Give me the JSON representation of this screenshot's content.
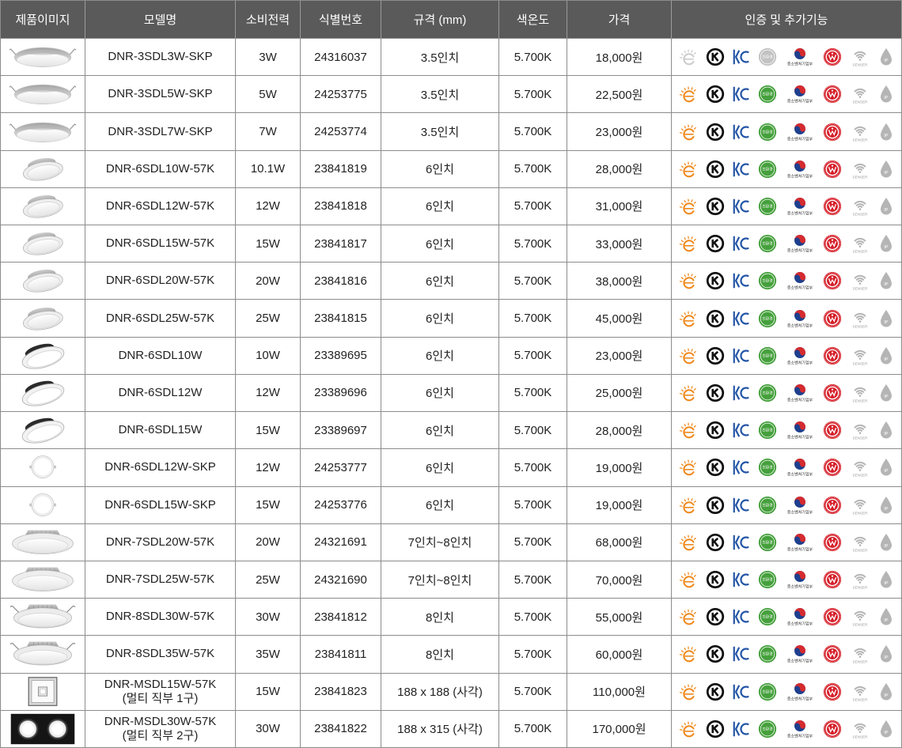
{
  "columns": [
    "제품이미지",
    "모델명",
    "소비전력",
    "식별번호",
    "규격 (mm)",
    "색온도",
    "가격",
    "인증 및 추가기능"
  ],
  "certifications": [
    {
      "icon": "high-efficiency-mark-icon"
    },
    {
      "icon": "k-mark-icon"
    },
    {
      "icon": "kc-mark-icon"
    },
    {
      "icon": "eco-mark-icon",
      "text": "친환경"
    },
    {
      "icon": "sme-ministry-mark-icon",
      "text": "중소벤처기업부"
    },
    {
      "icon": "quality-seal-icon"
    },
    {
      "icon": "sensor-icon",
      "text": "SENSER"
    },
    {
      "icon": "ip-rating-icon",
      "text": "IP"
    }
  ],
  "colors": {
    "header_bg": "#5a5a5a",
    "header_text": "#ffffff",
    "grid_line": "#8c8c8c",
    "body_text": "#222222",
    "efficiency_orange": "#f0891d",
    "kc_blue": "#2456a6",
    "eco_green": "#45a03c",
    "seal_red": "#d6202a",
    "feature_gray": "#b5b5b5"
  },
  "rows": [
    {
      "image": "slim-downlight",
      "model": "DNR-3SDL3W-SKP",
      "power": "3W",
      "id_number": "24316037",
      "size": "3.5인치",
      "color_temp": "5.700K",
      "price": "18,000원",
      "inactive_certs": [
        "high-efficiency-mark-icon",
        "eco-mark-icon"
      ]
    },
    {
      "image": "slim-downlight",
      "model": "DNR-3SDL5W-SKP",
      "power": "5W",
      "id_number": "24253775",
      "size": "3.5인치",
      "color_temp": "5.700K",
      "price": "22,500원"
    },
    {
      "image": "slim-downlight",
      "model": "DNR-3SDL7W-SKP",
      "power": "7W",
      "id_number": "24253774",
      "size": "3.5인치",
      "color_temp": "5.700K",
      "price": "23,000원"
    },
    {
      "image": "tilted-downlight",
      "model": "DNR-6SDL10W-57K",
      "power": "10.1W",
      "id_number": "23841819",
      "size": "6인치",
      "color_temp": "5.700K",
      "price": "28,000원"
    },
    {
      "image": "tilted-downlight",
      "model": "DNR-6SDL12W-57K",
      "power": "12W",
      "id_number": "23841818",
      "size": "6인치",
      "color_temp": "5.700K",
      "price": "31,000원"
    },
    {
      "image": "tilted-downlight",
      "model": "DNR-6SDL15W-57K",
      "power": "15W",
      "id_number": "23841817",
      "size": "6인치",
      "color_temp": "5.700K",
      "price": "33,000원"
    },
    {
      "image": "tilted-downlight",
      "model": "DNR-6SDL20W-57K",
      "power": "20W",
      "id_number": "23841816",
      "size": "6인치",
      "color_temp": "5.700K",
      "price": "38,000원"
    },
    {
      "image": "tilted-downlight",
      "model": "DNR-6SDL25W-57K",
      "power": "25W",
      "id_number": "23841815",
      "size": "6인치",
      "color_temp": "5.700K",
      "price": "45,000원"
    },
    {
      "image": "dark-housing-downlight",
      "model": "DNR-6SDL10W",
      "power": "10W",
      "id_number": "23389695",
      "size": "6인치",
      "color_temp": "5.700K",
      "price": "23,000원"
    },
    {
      "image": "dark-housing-downlight",
      "model": "DNR-6SDL12W",
      "power": "12W",
      "id_number": "23389696",
      "size": "6인치",
      "color_temp": "5.700K",
      "price": "25,000원"
    },
    {
      "image": "dark-housing-downlight",
      "model": "DNR-6SDL15W",
      "power": "15W",
      "id_number": "23389697",
      "size": "6인치",
      "color_temp": "5.700K",
      "price": "28,000원"
    },
    {
      "image": "round-downlight",
      "model": "DNR-6SDL12W-SKP",
      "power": "12W",
      "id_number": "24253777",
      "size": "6인치",
      "color_temp": "5.700K",
      "price": "19,000원"
    },
    {
      "image": "round-downlight",
      "model": "DNR-6SDL15W-SKP",
      "power": "15W",
      "id_number": "24253776",
      "size": "6인치",
      "color_temp": "5.700K",
      "price": "19,000원"
    },
    {
      "image": "wide-downlight",
      "model": "DNR-7SDL20W-57K",
      "power": "20W",
      "id_number": "24321691",
      "size": "7인치~8인치",
      "color_temp": "5.700K",
      "price": "68,000원"
    },
    {
      "image": "wide-downlight",
      "model": "DNR-7SDL25W-57K",
      "power": "25W",
      "id_number": "24321690",
      "size": "7인치~8인치",
      "color_temp": "5.700K",
      "price": "70,000원"
    },
    {
      "image": "wide-downlight-clips",
      "model": "DNR-8SDL30W-57K",
      "power": "30W",
      "id_number": "23841812",
      "size": "8인치",
      "color_temp": "5.700K",
      "price": "55,000원"
    },
    {
      "image": "wide-downlight-clips",
      "model": "DNR-8SDL35W-57K",
      "power": "35W",
      "id_number": "23841811",
      "size": "8인치",
      "color_temp": "5.700K",
      "price": "60,000원"
    },
    {
      "image": "square-single-lamp",
      "model": "DNR-MSDL15W-57K",
      "model_note": "(멀티 직부 1구)",
      "power": "15W",
      "id_number": "23841823",
      "size": "188 x 188 (사각)",
      "color_temp": "5.700K",
      "price": "110,000원"
    },
    {
      "image": "square-double-lamp",
      "model": "DNR-MSDL30W-57K",
      "model_note": "(멀티 직부 2구)",
      "power": "30W",
      "id_number": "23841822",
      "size": "188 x 315 (사각)",
      "color_temp": "5.700K",
      "price": "170,000원"
    }
  ]
}
